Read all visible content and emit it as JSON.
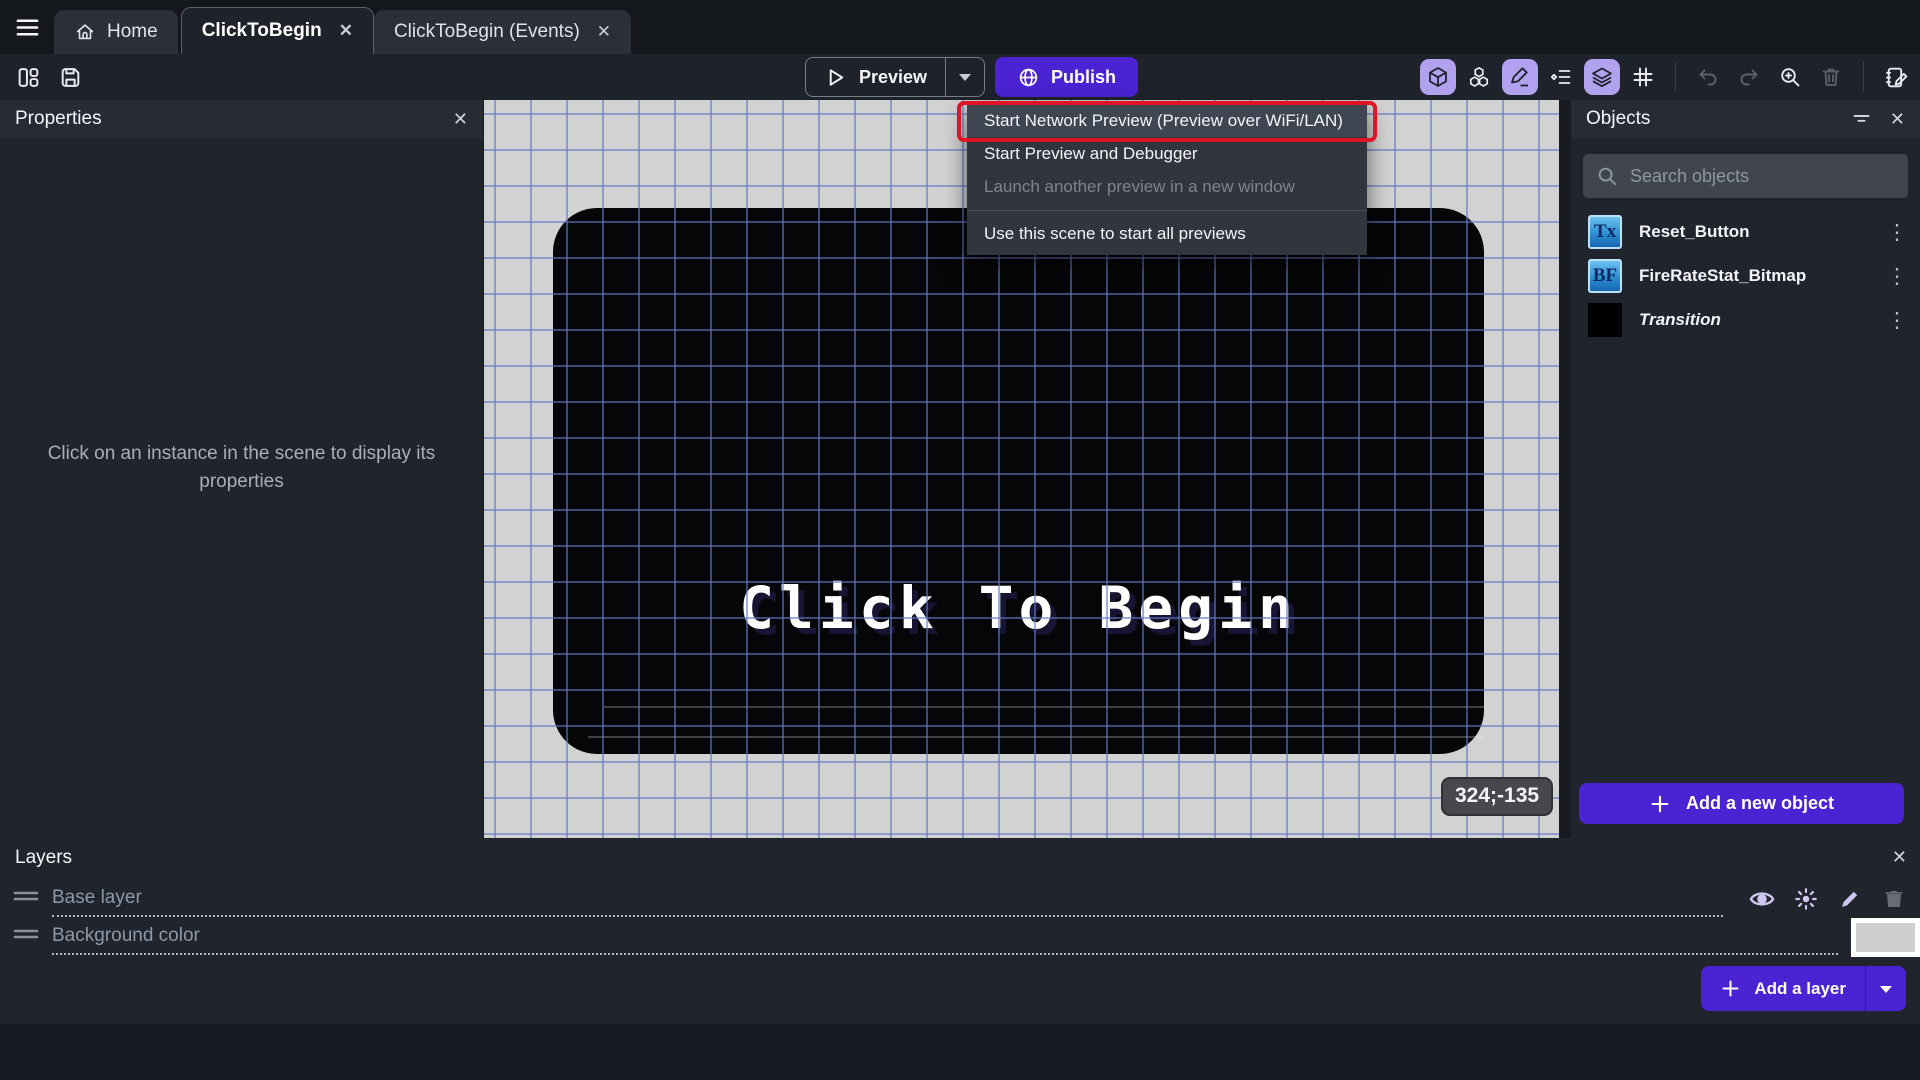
{
  "colors": {
    "accent_purple": "#4b23d3",
    "active_icon_lavender": "#b2a1ee",
    "annotation_red": "#e11425",
    "canvas_background": "#d2d2d2",
    "grid_blue": "#6278c6",
    "object_icon_blue": "#2d8fd2"
  },
  "icons": {
    "close": "✕",
    "kebab": "⋮"
  },
  "tab_bar": {
    "tabs": [
      {
        "label": "Home"
      },
      {
        "label": "ClickToBegin",
        "active": true
      },
      {
        "label": "ClickToBegin (Events)"
      }
    ]
  },
  "toolbar": {
    "preview_label": "Preview",
    "publish_label": "Publish"
  },
  "preview_menu": {
    "items": [
      {
        "label": "Start Network Preview (Preview over WiFi/LAN)",
        "state": "highlighted"
      },
      {
        "label": "Start Preview and Debugger",
        "state": "normal"
      },
      {
        "label": "Launch another preview in a new window",
        "state": "disabled"
      },
      {
        "label": "Use this scene to start all previews",
        "state": "normal"
      }
    ]
  },
  "properties_panel": {
    "title": "Properties",
    "empty_message": "Click on an instance in the scene to display its properties"
  },
  "scene_canvas": {
    "game_text": "Click To Begin",
    "cursor_coordinates": "324;-135"
  },
  "objects_panel": {
    "title": "Objects",
    "search_placeholder": "Search objects",
    "objects": [
      {
        "name": "Reset_Button",
        "icon_text": "Tx"
      },
      {
        "name": "FireRateStat_Bitmap",
        "icon_text": "BF"
      },
      {
        "name": "Transition",
        "icon_text": ""
      }
    ],
    "add_button_label": "Add a new object"
  },
  "layers_panel": {
    "title": "Layers",
    "layers": [
      {
        "name": "Base layer"
      },
      {
        "name": "Background color"
      }
    ],
    "add_button_label": "Add a layer"
  }
}
